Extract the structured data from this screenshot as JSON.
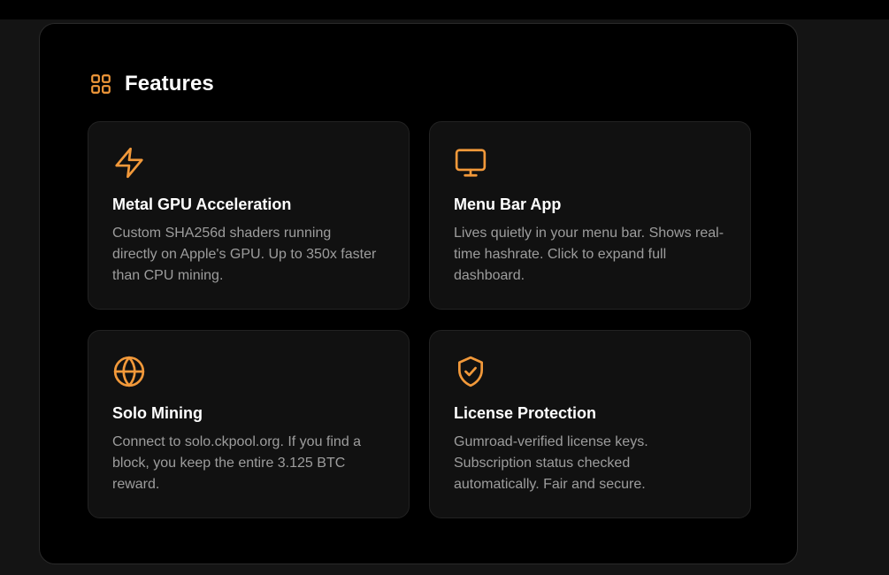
{
  "section": {
    "title": "Features",
    "icon": "grid-icon"
  },
  "colors": {
    "accent": "#F2993A",
    "panel_bg": "#000000",
    "card_bg": "#111111",
    "title_text": "#FFFFFF",
    "desc_text": "#9D9D9D"
  },
  "features": [
    {
      "icon": "lightning-bolt-icon",
      "title": "Metal GPU Acceleration",
      "desc_lines": [
        "Custom SHA256d shaders running",
        "directly on Apple's GPU. Up to 350x faster",
        "than CPU mining."
      ]
    },
    {
      "icon": "monitor-icon",
      "title": "Menu Bar App",
      "desc_lines": [
        "Lives quietly in your menu bar. Shows real-",
        "time hashrate. Click to expand full",
        "dashboard."
      ]
    },
    {
      "icon": "globe-icon",
      "title": "Solo Mining",
      "desc_lines": [
        "Connect to solo.ckpool.org. If you find a",
        "block, you keep the entire 3.125 BTC",
        "reward."
      ]
    },
    {
      "icon": "shield-check-icon",
      "title": "License Protection",
      "desc_lines": [
        "Gumroad-verified license keys.",
        "Subscription status checked",
        "automatically. Fair and secure."
      ]
    }
  ]
}
